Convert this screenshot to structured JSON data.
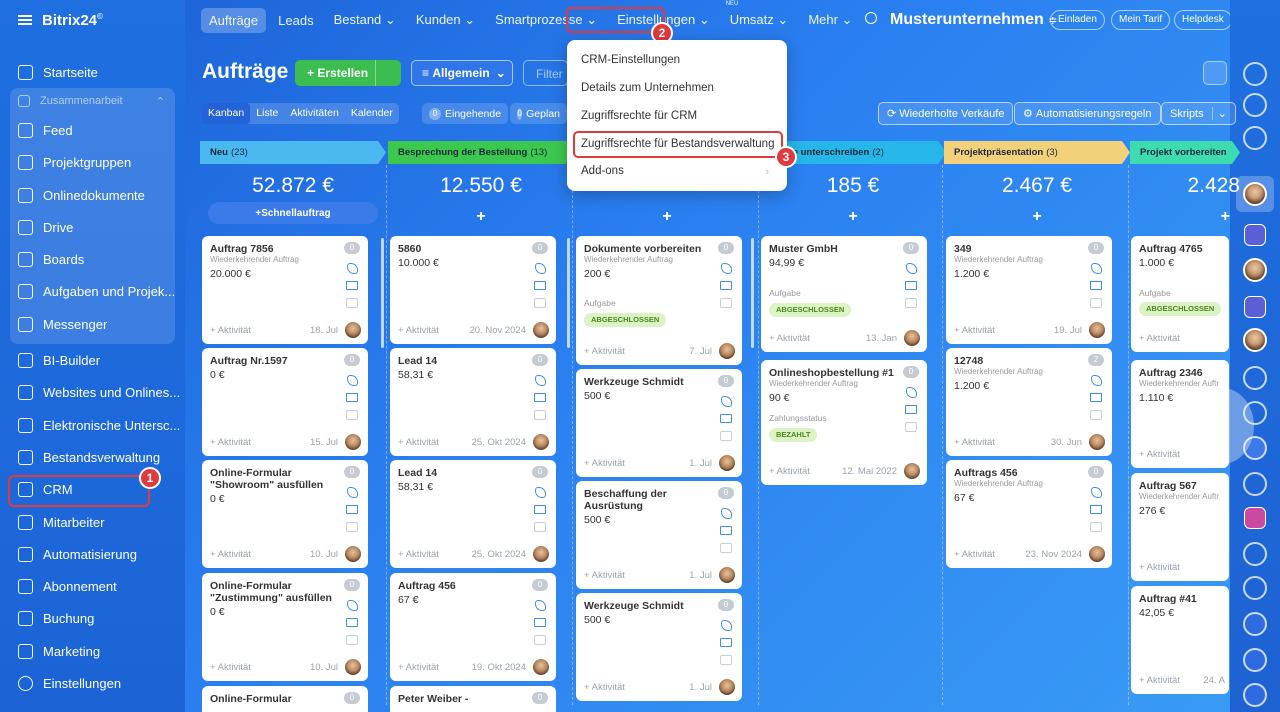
{
  "app": {
    "logo": "Bitrix24",
    "logo_mark": "©"
  },
  "sidebar": {
    "items_top": [
      {
        "label": "Startseite",
        "icon": "home-icon"
      }
    ],
    "group": {
      "label": "Zusammenarbeit",
      "items": [
        {
          "label": "Feed",
          "icon": "feed-icon"
        },
        {
          "label": "Projektgruppen",
          "icon": "groups-icon"
        },
        {
          "label": "Onlinedokumente",
          "icon": "document-icon"
        },
        {
          "label": "Drive",
          "icon": "drive-icon"
        },
        {
          "label": "Boards",
          "icon": "boards-icon"
        },
        {
          "label": "Aufgaben und Projek...",
          "icon": "tasks-icon"
        },
        {
          "label": "Messenger",
          "icon": "messenger-icon"
        }
      ]
    },
    "items": [
      {
        "label": "BI-Builder",
        "icon": "chart-icon"
      },
      {
        "label": "Websites und Onlines...",
        "icon": "cart-icon"
      },
      {
        "label": "Elektronische Untersc...",
        "icon": "signature-icon"
      },
      {
        "label": "Bestandsverwaltung",
        "icon": "inventory-icon"
      },
      {
        "label": "CRM",
        "icon": "crm-icon"
      },
      {
        "label": "Mitarbeiter",
        "icon": "employees-icon"
      },
      {
        "label": "Automatisierung",
        "icon": "automation-icon"
      },
      {
        "label": "Abonnement",
        "icon": "subscription-icon"
      },
      {
        "label": "Buchung",
        "icon": "booking-icon"
      },
      {
        "label": "Marketing",
        "icon": "marketing-icon"
      },
      {
        "label": "Einstellungen",
        "icon": "settings-icon"
      }
    ]
  },
  "topnav": {
    "tabs": [
      "Aufträge",
      "Leads",
      "Bestand",
      "Kunden",
      "Smartprozesse",
      "Einstellungen",
      "Umsatz",
      "Mehr"
    ],
    "new_badge": "NEU",
    "company": "Musterunternehmen",
    "invite": "Einladen",
    "tariff": "Mein Tarif",
    "helpdesk": "Helpdesk"
  },
  "toolbar": {
    "title": "Aufträge",
    "create": "Erstellen",
    "general": "Allgemein",
    "filter_placeholder": "Filter"
  },
  "views": [
    "Kanban",
    "Liste",
    "Aktivitäten",
    "Kalender"
  ],
  "counters": [
    {
      "n": "0",
      "label": "Eingehende"
    },
    {
      "n": "0",
      "label": "Geplan"
    }
  ],
  "right_buttons": {
    "recurring": "Wiederholte Verkäufe",
    "rules": "Automatisierungsregeln",
    "scripts": "Skripts"
  },
  "dropdown": {
    "items": [
      "CRM-Einstellungen",
      "Details zum Unternehmen",
      "Zugriffsrechte für CRM",
      "Zugriffsrechte für Bestandsverwaltung",
      "Add-ons"
    ]
  },
  "markers": [
    "1",
    "2",
    "3"
  ],
  "common": {
    "activity": "+ Aktivität",
    "quick": "Schnellauftrag",
    "plus": "+",
    "recurring_sub": "Wiederkehrender Auftrag",
    "aufgabe": "Aufgabe",
    "done": "ABGESCHLOSSEN",
    "zahlungsstatus": "Zahlungsstatus",
    "paid": "BEZAHLT"
  },
  "columns": [
    {
      "name": "Neu",
      "count": "(23)",
      "sum": "52.872 €",
      "color": "#4cb8f0"
    },
    {
      "name": "Besprechung der Bestellung",
      "count": "(13)",
      "sum": "12.550 €",
      "color": "#3cc84f"
    },
    {
      "name": "",
      "count": "",
      "sum": "",
      "color": "#a1d7f3"
    },
    {
      "name": "mente unterschreiben",
      "count": "(2)",
      "sum": "185 €",
      "color": "#27b6e8"
    },
    {
      "name": "Projektpräsentation",
      "count": "(3)",
      "sum": "2.467 €",
      "color": "#f3d07a"
    },
    {
      "name": "Projekt vorbereiten",
      "count": "",
      "sum": "2.428",
      "color": "#3fdbb0"
    }
  ],
  "cards": {
    "c0": [
      {
        "t": "Auftrag 7856",
        "sub": "Wiederkehrender Auftrag",
        "v": "20.000 €",
        "n": "0",
        "d": "18. Jul"
      },
      {
        "t": "Auftrag Nr.1597",
        "v": "0 €",
        "n": "0",
        "d": "15. Jul"
      },
      {
        "t": "Online-Formular \"Showroom\" ausfüllen",
        "v": "0 €",
        "n": "0",
        "d": "10. Jul"
      },
      {
        "t": "Online-Formular \"Zustimmung\" ausfüllen",
        "v": "0 €",
        "n": "0",
        "d": "10. Jul"
      },
      {
        "t": "Online-Formular",
        "n": "0"
      }
    ],
    "c1": [
      {
        "t": "5860",
        "v": "10.000 €",
        "n": "0",
        "d": "20. Nov 2024"
      },
      {
        "t": "Lead 14",
        "v": "58,31 €",
        "n": "0",
        "d": "25. Okt 2024"
      },
      {
        "t": "Lead 14",
        "v": "58,31 €",
        "n": "0",
        "d": "25. Okt 2024"
      },
      {
        "t": "Auftrag 456",
        "v": "67 €",
        "n": "0",
        "d": "19. Okt 2024"
      },
      {
        "t": "Peter Weiber -",
        "n": "0"
      }
    ],
    "c2": [
      {
        "t": "Dokumente vorbereiten",
        "sub": "Wiederkehrender Auftrag",
        "v": "200 €",
        "n": "0",
        "d": "7. Jul"
      },
      {
        "t": "Werkzeuge Schmidt",
        "v": "500 €",
        "n": "0",
        "d": "1. Jul"
      },
      {
        "t": "Beschaffung der Ausrüstung",
        "v": "500 €",
        "n": "0",
        "d": "1. Jul"
      },
      {
        "t": "Werkzeuge Schmidt",
        "v": "500 €",
        "n": "0",
        "d": "1. Jul"
      }
    ],
    "c3": [
      {
        "t": "Muster GmbH",
        "v": "94,99 €",
        "n": "0",
        "d": "13. Jan"
      },
      {
        "t": "Onlineshopbestellung #1",
        "sub": "Wiederkehrender Auftrag",
        "v": "90 €",
        "n": "0",
        "d": "12. Mai 2022"
      }
    ],
    "c4": [
      {
        "t": "349",
        "sub": "Wiederkehrender Auftrag",
        "v": "1.200 €",
        "n": "0",
        "d": "19. Jul"
      },
      {
        "t": "12748",
        "sub": "Wiederkehrender Auftrag",
        "v": "1.200 €",
        "n": "2",
        "d": "30. Jun"
      },
      {
        "t": "Auftrags 456",
        "sub": "Wiederkehrender Auftrag",
        "v": "67 €",
        "n": "0",
        "d": "23. Nov 2024"
      }
    ],
    "c5": [
      {
        "t": "Auftrag 4765",
        "v": "1.000 €",
        "d": ""
      },
      {
        "t": "Auftrag 2346",
        "sub": "Wiederkehrender Auftr",
        "v": "1.110 €",
        "d": ""
      },
      {
        "t": "Auftrag 567",
        "sub": "Wiederkehrender Auftr",
        "v": "276 €",
        "d": ""
      },
      {
        "t": "Auftrag #41",
        "v": "42,05 €",
        "d": "24. A"
      }
    ]
  }
}
